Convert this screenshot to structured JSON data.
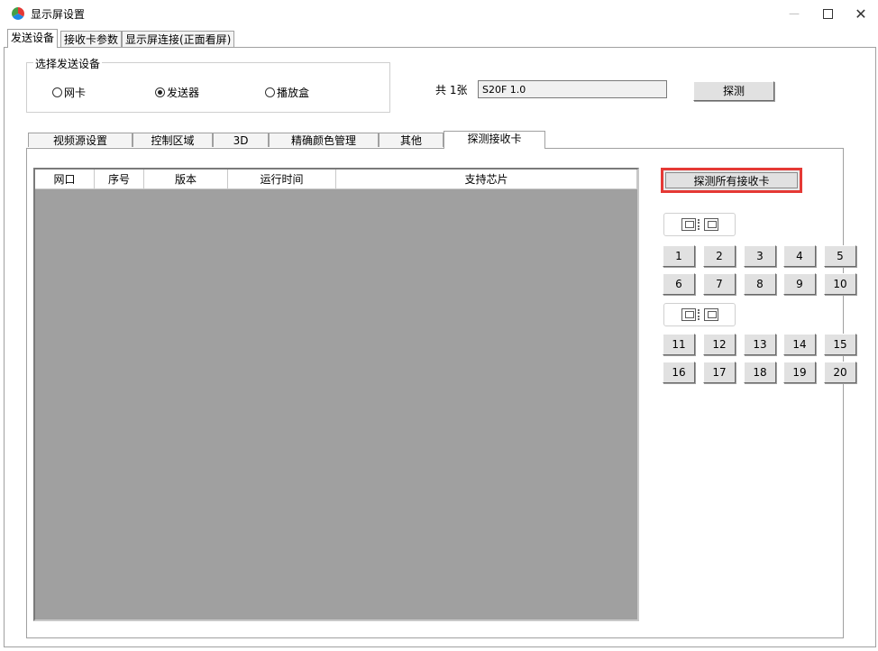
{
  "window": {
    "title": "显示屏设置"
  },
  "main_tabs": [
    "发送设备",
    "接收卡参数",
    "显示屏连接(正面看屏)"
  ],
  "sender_group": {
    "legend": "选择发送设备",
    "options": [
      "网卡",
      "发送器",
      "播放盒"
    ],
    "selected": "发送器"
  },
  "count_label": "共 1张",
  "device_value": "S20F 1.0",
  "detect_button": "探测",
  "sub_tabs": [
    "视频源设置",
    "控制区域",
    "3D",
    "精确颜色管理",
    "其他",
    "探测接收卡"
  ],
  "active_sub_tab": "探测接收卡",
  "table": {
    "columns": [
      "网口",
      "序号",
      "版本",
      "运行时间",
      "支持芯片"
    ],
    "rows": []
  },
  "detect_all_button": "探测所有接收卡",
  "port_groups": [
    {
      "buttons": [
        "1",
        "2",
        "3",
        "4",
        "5",
        "6",
        "7",
        "8",
        "9",
        "10"
      ]
    },
    {
      "buttons": [
        "11",
        "12",
        "13",
        "14",
        "15",
        "16",
        "17",
        "18",
        "19",
        "20"
      ]
    }
  ],
  "colors": {
    "table_bg": "#a0a0a0",
    "highlight": "#e53935"
  }
}
